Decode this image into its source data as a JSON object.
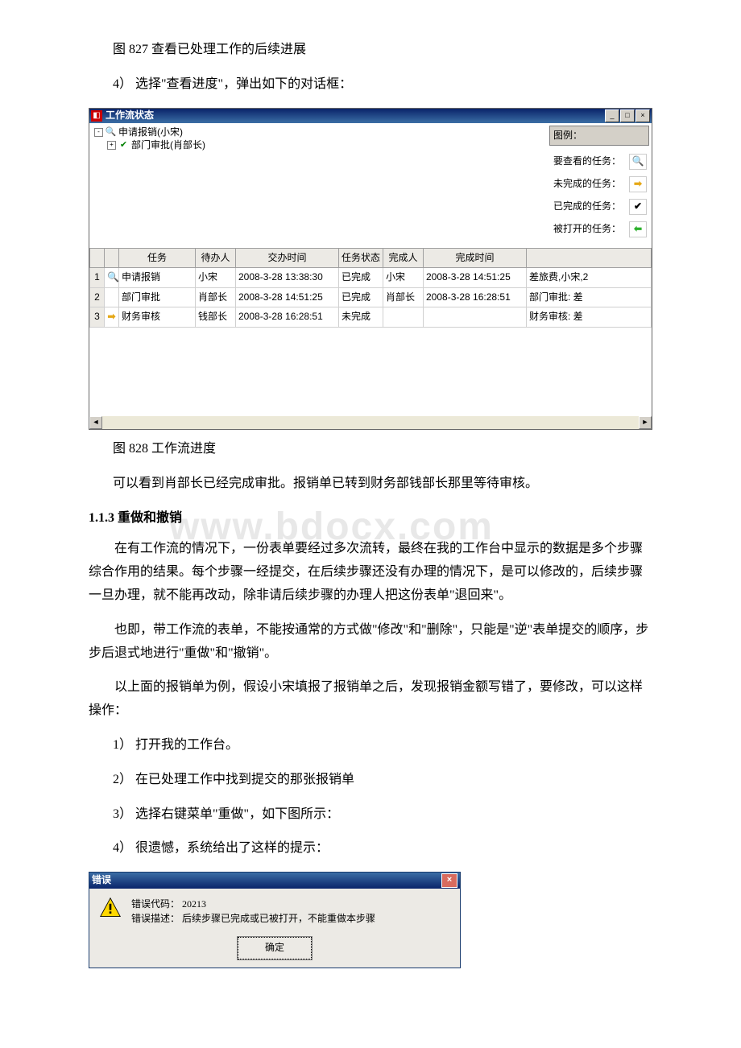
{
  "captions": {
    "fig827": "图 827 查看已处理工作的后续进展",
    "step4": "4） 选择\"查看进度\"，弹出如下的对话框：",
    "fig828": "图 828 工作流进度",
    "after828": "可以看到肖部长已经完成审批。报销单已转到财务部钱部长那里等待审核。",
    "heading113": "1.1.3 重做和撤销",
    "p1": "在有工作流的情况下，一份表单要经过多次流转，最终在我的工作台中显示的数据是多个步骤综合作用的结果。每个步骤一经提交，在后续步骤还没有办理的情况下，是可以修改的，后续步骤一旦办理，就不能再改动，除非请后续步骤的办理人把这份表单\"退回来\"。",
    "p2": "也即，带工作流的表单，不能按通常的方式做\"修改\"和\"删除\"，只能是\"逆\"表单提交的顺序，步步后退式地进行\"重做\"和\"撤销\"。",
    "p3": "以上面的报销单为例，假设小宋填报了报销单之后，发现报销金额写错了，要修改，可以这样操作：",
    "s1": "1） 打开我的工作台。",
    "s2": "2） 在已处理工作中找到提交的那张报销单",
    "s3": "3） 选择右键菜单\"重做\"，如下图所示：",
    "s4": "4） 很遗憾，系统给出了这样的提示："
  },
  "watermark": "www.bdocx.com",
  "window": {
    "title": "工作流状态",
    "tree": {
      "root": "申请报销(小宋)",
      "child": "部门审批(肖部长)"
    },
    "legend": {
      "title": "图例：",
      "items": [
        {
          "label": "要查看的任务：",
          "icon": "magnifier"
        },
        {
          "label": "未完成的任务：",
          "icon": "arrow-right"
        },
        {
          "label": "已完成的任务：",
          "icon": "check"
        },
        {
          "label": "被打开的任务：",
          "icon": "arrow-left"
        }
      ]
    },
    "columns": [
      "",
      "",
      "任务",
      "待办人",
      "交办时间",
      "任务状态",
      "完成人",
      "完成时间",
      ""
    ],
    "rows": [
      {
        "n": "1",
        "icon": "magnifier",
        "task": "申请报销",
        "assignee": "小宋",
        "assign_time": "2008-3-28 13:38:30",
        "status": "已完成",
        "doneby": "小宋",
        "done_time": "2008-3-28 14:51:25",
        "extra": "差旅费,小宋,2"
      },
      {
        "n": "2",
        "icon": "",
        "task": "部门审批",
        "assignee": "肖部长",
        "assign_time": "2008-3-28 14:51:25",
        "status": "已完成",
        "doneby": "肖部长",
        "done_time": "2008-3-28 16:28:51",
        "extra": "部门审批: 差"
      },
      {
        "n": "3",
        "icon": "arrow-right",
        "task": "财务审核",
        "assignee": "钱部长",
        "assign_time": "2008-3-28 16:28:51",
        "status": "未完成",
        "doneby": "",
        "done_time": "",
        "extra": "财务审核: 差"
      }
    ]
  },
  "error": {
    "title": "错误",
    "code_label": "错误代码：",
    "code": "20213",
    "desc_label": "错误描述：",
    "desc": "后续步骤已完成或已被打开，不能重做本步骤",
    "ok": "确定"
  }
}
